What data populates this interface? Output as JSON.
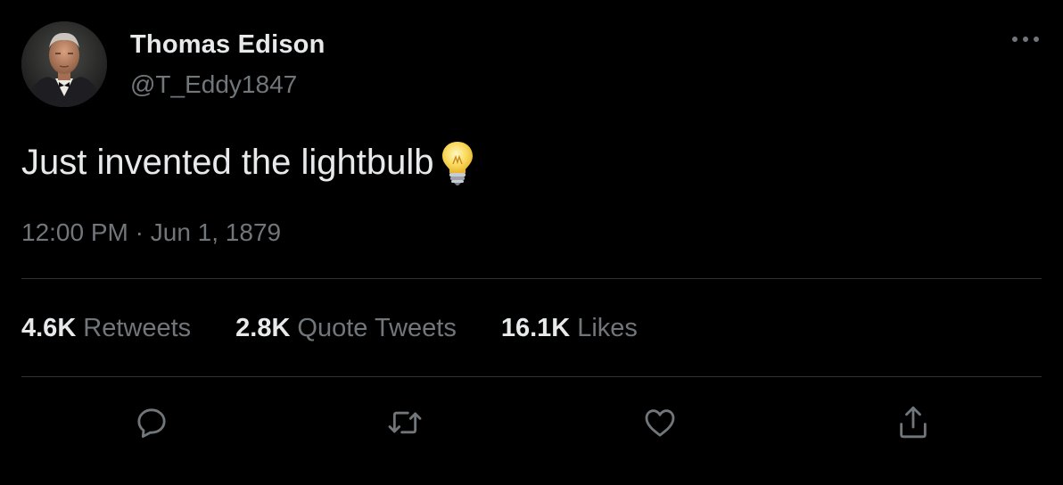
{
  "author": {
    "display_name": "Thomas Edison",
    "handle": "@T_Eddy1847"
  },
  "tweet": {
    "text": "Just invented the lightbulb",
    "emoji_icon": "lightbulb-icon",
    "time": "12:00 PM",
    "separator": "·",
    "date": "Jun 1, 1879"
  },
  "stats": {
    "retweets": {
      "count": "4.6K",
      "label": "Retweets"
    },
    "quote_tweets": {
      "count": "2.8K",
      "label": "Quote Tweets"
    },
    "likes": {
      "count": "16.1K",
      "label": "Likes"
    }
  },
  "actions": {
    "reply_icon": "reply-icon",
    "retweet_icon": "retweet-icon",
    "like_icon": "heart-icon",
    "share_icon": "share-icon"
  },
  "colors": {
    "background": "#000000",
    "primary_text": "#e7e9ea",
    "secondary_text": "#71767b",
    "divider": "#2f3336"
  }
}
